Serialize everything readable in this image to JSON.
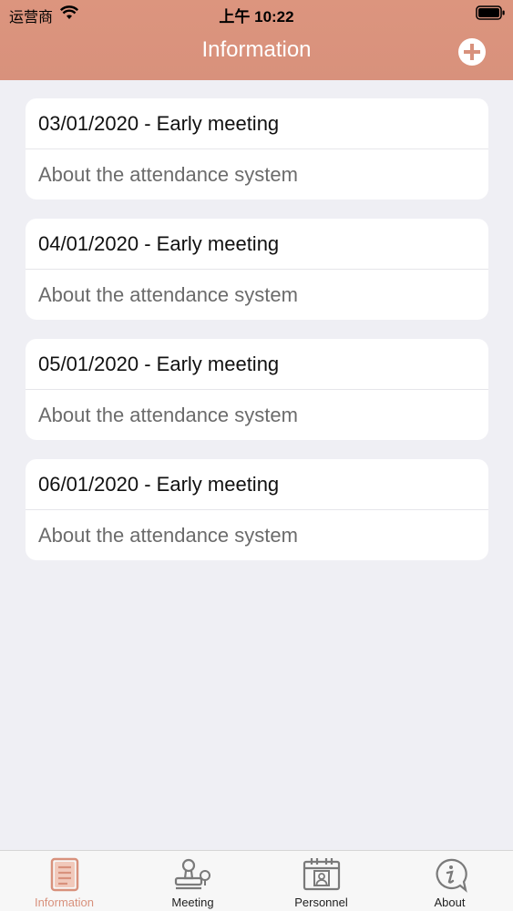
{
  "status_bar": {
    "carrier": "运营商",
    "time": "上午 10:22"
  },
  "header": {
    "title": "Information"
  },
  "items": [
    {
      "title": "03/01/2020 - Early meeting",
      "subtitle": "About the attendance system"
    },
    {
      "title": "04/01/2020 - Early meeting",
      "subtitle": "About the attendance system"
    },
    {
      "title": "05/01/2020 - Early meeting",
      "subtitle": "About the attendance system"
    },
    {
      "title": "06/01/2020 - Early meeting",
      "subtitle": "About the attendance system"
    }
  ],
  "tabs": [
    {
      "label": "Information",
      "icon": "document-icon",
      "active": true
    },
    {
      "label": "Meeting",
      "icon": "stamp-icon",
      "active": false
    },
    {
      "label": "Personnel",
      "icon": "calendar-person-icon",
      "active": false
    },
    {
      "label": "About",
      "icon": "info-chat-icon",
      "active": false
    }
  ],
  "colors": {
    "accent": "#d8917c",
    "background": "#efeff4",
    "inactive_icon": "#7a7a7a"
  }
}
